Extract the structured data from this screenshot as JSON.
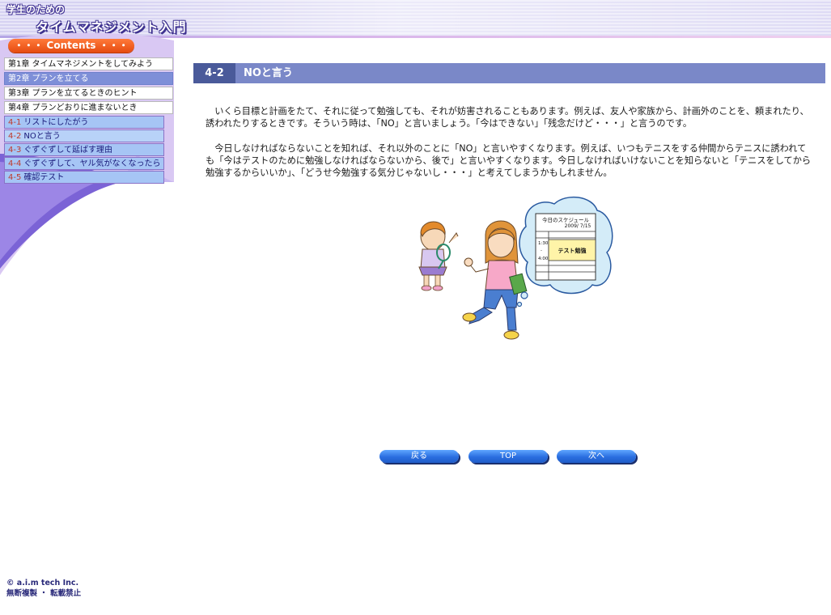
{
  "header": {
    "title_small": "学生のための",
    "title_main": "タイムマネジメント入門"
  },
  "sidebar": {
    "contents_label": "・・・ Contents ・・・",
    "chapters": [
      {
        "label": "第1章 タイムマネジメントをしてみよう"
      },
      {
        "label": "第2章 プランを立てる"
      },
      {
        "label": "第3章 プランを立てるときのヒント"
      },
      {
        "label": "第4章 プランどおりに進まないとき"
      }
    ],
    "subitems": [
      {
        "num": "4-1",
        "label": "リストにしたがう"
      },
      {
        "num": "4-2",
        "label": "NOと言う"
      },
      {
        "num": "4-3",
        "label": "ぐずぐずして延ばす理由"
      },
      {
        "num": "4-4",
        "label": "ぐずぐずして、ヤル気がなくなったら"
      },
      {
        "num": "4-5",
        "label": "確認テスト"
      }
    ]
  },
  "main": {
    "section_number": "4-2",
    "section_title": "NOと言う",
    "paragraphs": [
      "いくら目標と計画をたて、それに従って勉強しても、それが妨害されることもあります。例えば、友人や家族から、計画外のことを、頼まれたり、誘われたりするときです。そういう時は、「NO」と言いましょう。「今はできない」「残念だけど・・・」と言うのです。",
      "今日しなければならないことを知れば、それ以外のことに「NO」と言いやすくなります。例えば、いつもテニスをする仲間からテニスに誘われても「今はテストのために勉強しなければならないから、後で」と言いやすくなります。今日しなければいけないことを知らないと「テニスをしてから勉強するからいいか」、「どうせ今勉強する気分じゃないし・・・」と考えてしまうかもしれません。"
    ],
    "illustration": {
      "bubble_title": "今日のスケジュール",
      "bubble_date": "2009/ 7/15",
      "bubble_time_start": "1:30",
      "bubble_time_sep": "-",
      "bubble_time_end": "4:00",
      "bubble_task": "テスト勉強"
    }
  },
  "buttons": {
    "back": "戻る",
    "top": "TOP",
    "next": "次へ"
  },
  "footer": {
    "copyright": "© a.i.m tech Inc.",
    "notice": "無断複製 ・ 転載禁止"
  },
  "colors": {
    "section_bar": "#7a88c8",
    "section_num_bg": "#4a5a9a",
    "contents_pill": "#f05a1c",
    "button_blue": "#2a6ee0",
    "sub_item_bg": "#a6c5f5"
  }
}
